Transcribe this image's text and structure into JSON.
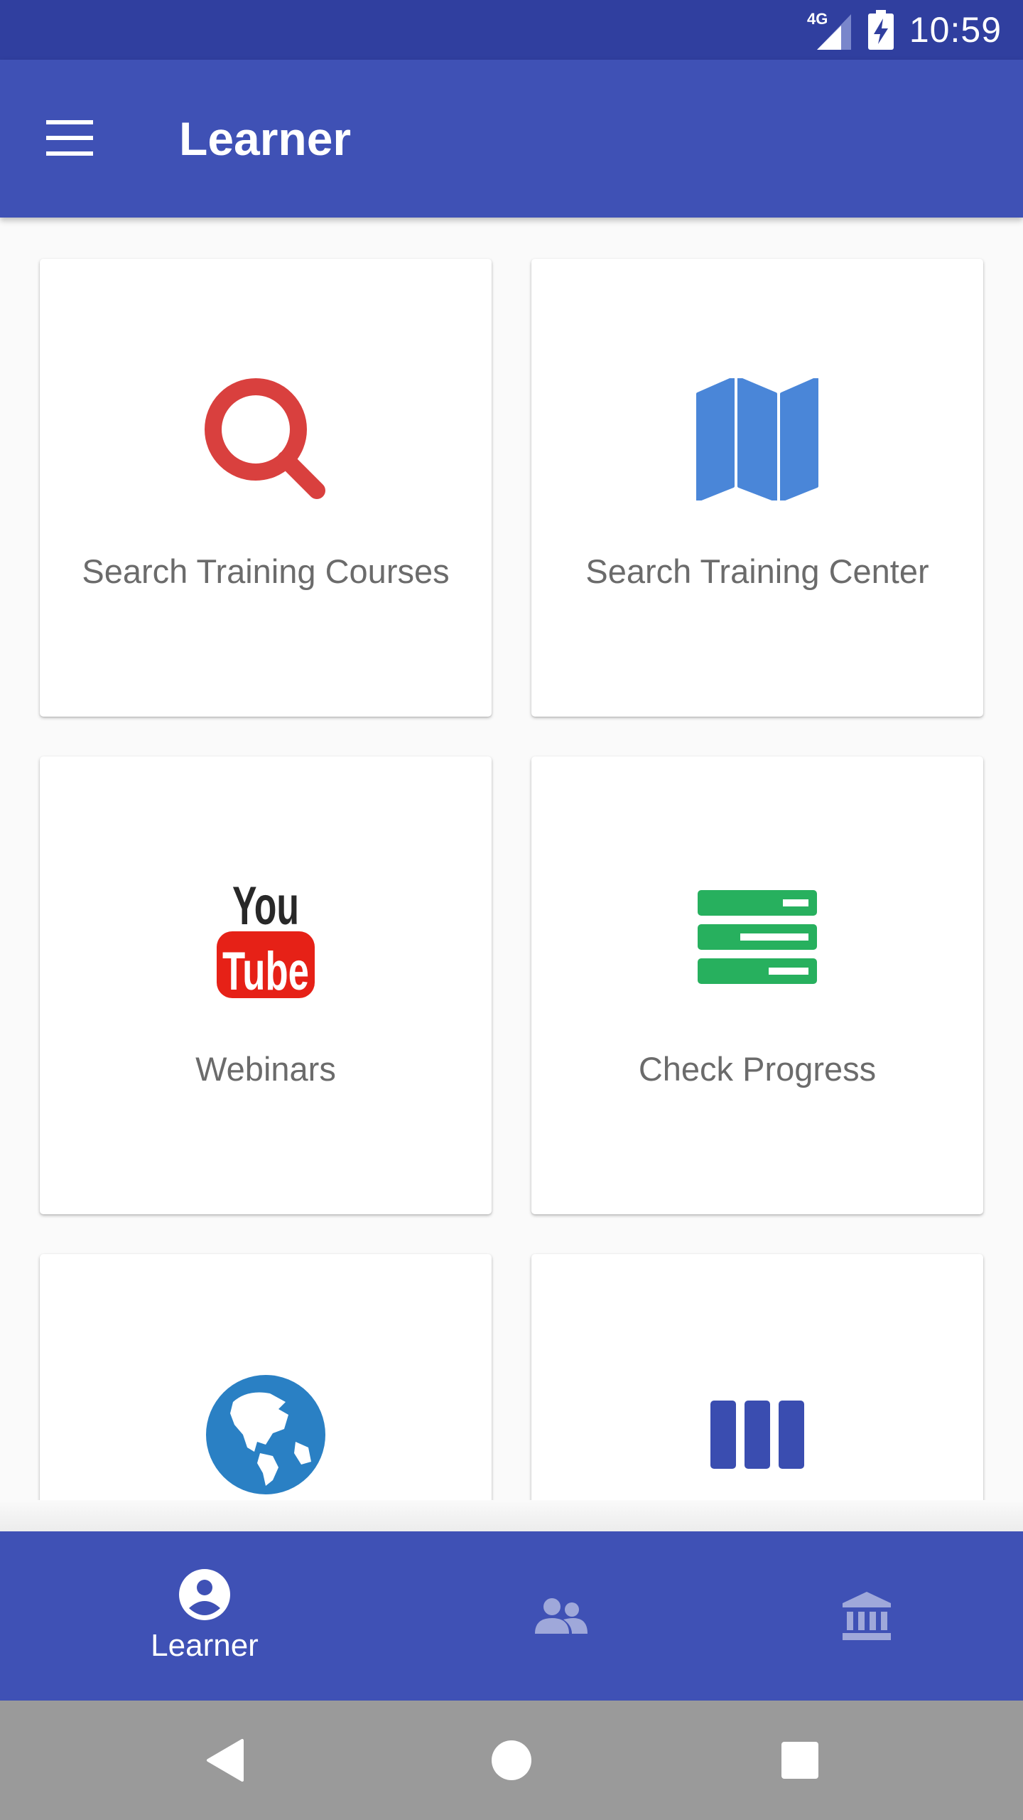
{
  "status_bar": {
    "network": "4G",
    "time": "10:59"
  },
  "app_bar": {
    "title": "Learner",
    "menu_icon": "menu-icon"
  },
  "cards": [
    {
      "label": "Search Training Courses",
      "icon": "search-icon",
      "color": "#d9403e"
    },
    {
      "label": "Search Training Center",
      "icon": "map-icon",
      "color": "#4a86d8"
    },
    {
      "label": "Webinars",
      "icon": "youtube-icon",
      "color": "#e62117"
    },
    {
      "label": "Check Progress",
      "icon": "progress-list-icon",
      "color": "#27b05e"
    },
    {
      "label": "",
      "icon": "globe-icon",
      "color": "#2a80c4"
    },
    {
      "label": "",
      "icon": "columns-icon",
      "color": "#3a4db0"
    }
  ],
  "bottom_nav": {
    "items": [
      {
        "label": "Learner",
        "icon": "account-circle-icon",
        "selected": true
      },
      {
        "label": "",
        "icon": "people-icon",
        "selected": false
      },
      {
        "label": "",
        "icon": "institution-icon",
        "selected": false
      }
    ]
  },
  "system_nav": {
    "back": "back-icon",
    "home": "home-icon",
    "recents": "recents-icon"
  },
  "colors": {
    "primary": "#3f51b5",
    "primary_dark": "#303f9f",
    "background": "#fafafa",
    "system_nav": "#9a9a9a"
  }
}
